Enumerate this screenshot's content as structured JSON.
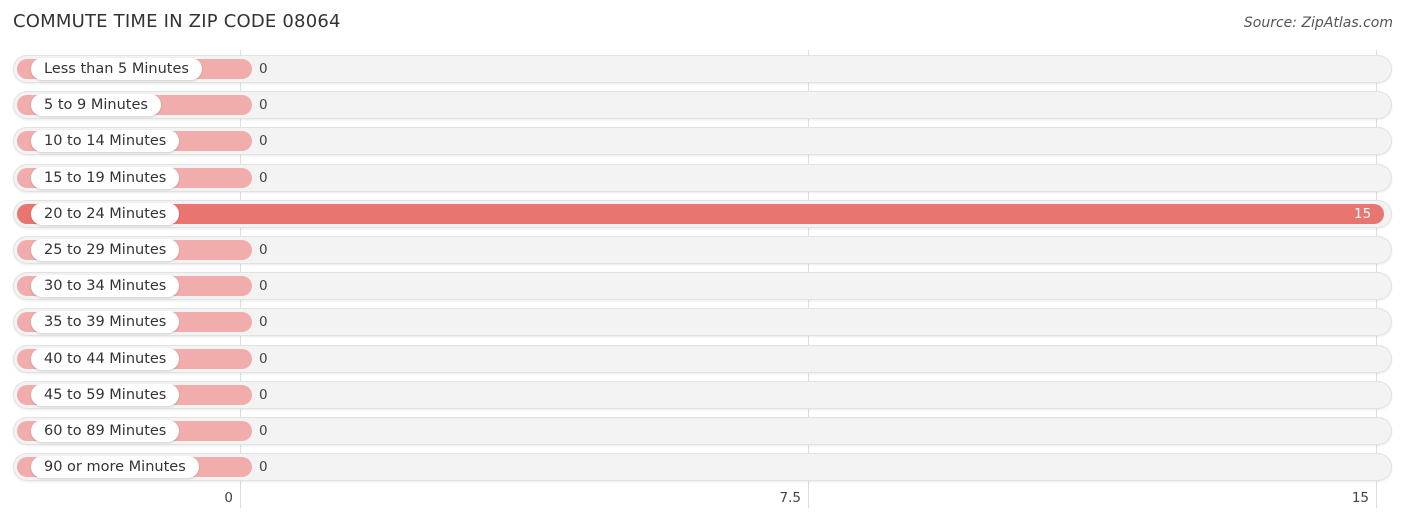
{
  "chart_data": {
    "type": "bar",
    "orientation": "horizontal",
    "title": "COMMUTE TIME IN ZIP CODE 08064",
    "source": "Source: ZipAtlas.com",
    "categories": [
      "Less than 5 Minutes",
      "5 to 9 Minutes",
      "10 to 14 Minutes",
      "15 to 19 Minutes",
      "20 to 24 Minutes",
      "25 to 29 Minutes",
      "30 to 34 Minutes",
      "35 to 39 Minutes",
      "40 to 44 Minutes",
      "45 to 59 Minutes",
      "60 to 89 Minutes",
      "90 or more Minutes"
    ],
    "values": [
      0,
      0,
      0,
      0,
      15,
      0,
      0,
      0,
      0,
      0,
      0,
      0
    ],
    "xlim": [
      0,
      15
    ],
    "ticks": [
      {
        "value": 0,
        "label": "0"
      },
      {
        "value": 7.5,
        "label": "7.5"
      },
      {
        "value": 15,
        "label": "15"
      }
    ],
    "grid": true,
    "legend": "none",
    "colors": {
      "highlight": "#e8756f",
      "normal": "#f0adab"
    }
  }
}
